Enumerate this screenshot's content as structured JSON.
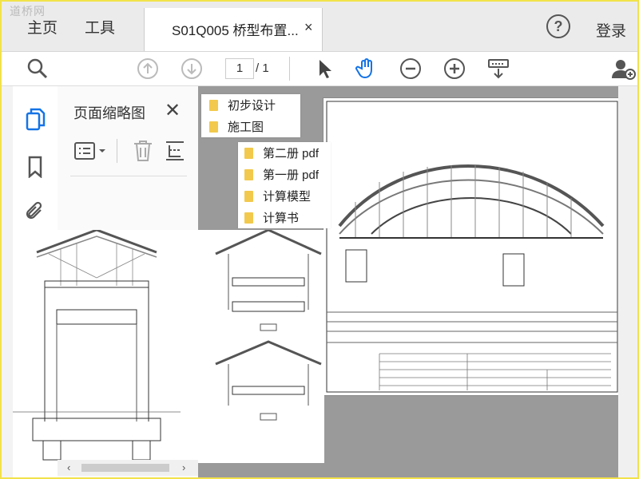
{
  "watermark": "道桥网",
  "tabs": {
    "home": "主页",
    "tools": "工具",
    "document_title": "S01Q005 桥型布置...",
    "close": "×"
  },
  "header": {
    "help": "?",
    "login": "登录"
  },
  "toolbar": {
    "current_page": "1",
    "page_total": "/ 1"
  },
  "thumbnail_panel": {
    "title": "页面缩略图",
    "close": "✕"
  },
  "file_menu": {
    "level1": [
      {
        "label": "初步设计"
      },
      {
        "label": "施工图"
      }
    ],
    "level2": [
      {
        "label": "第二册 pdf"
      },
      {
        "label": "第一册 pdf"
      },
      {
        "label": "计算模型"
      },
      {
        "label": "计算书"
      }
    ]
  },
  "colors": {
    "accent": "#1473e6",
    "folder": "#f2c94c",
    "frame": "#f2e24a",
    "doc_bg": "#9a9a9a"
  },
  "icons": [
    "search-icon",
    "arrow-up-icon",
    "arrow-down-icon",
    "pointer-icon",
    "hand-icon",
    "zoom-out-icon",
    "zoom-in-icon",
    "keyboard-scroll-icon",
    "add-user-icon",
    "pages-icon",
    "bookmark-icon",
    "attachment-icon",
    "options-icon",
    "trash-icon",
    "extract-icon"
  ]
}
